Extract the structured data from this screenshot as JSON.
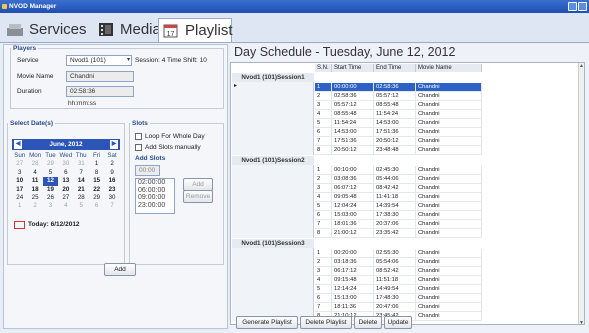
{
  "window": {
    "title": "NVOD Manager"
  },
  "tabs": [
    {
      "label": "Services",
      "icon": "services-icon"
    },
    {
      "label": "Media",
      "icon": "film-icon"
    },
    {
      "label": "Playlist",
      "icon": "calendar-icon"
    }
  ],
  "players": {
    "legend": "Players",
    "service_label": "Service",
    "service_value": "Nvod1 (101)",
    "session_info": "Session: 4 Time Shift: 10",
    "movie_label": "Movie Name",
    "movie_value": "Chandni",
    "duration_label": "Duration",
    "duration_value": "02:58:36",
    "duration_hint": "hh:mm:ss"
  },
  "dates": {
    "legend": "Select Date(s)",
    "month_title": "June, 2012",
    "weekdays": [
      "Sun",
      "Mon",
      "Tue",
      "Wed",
      "Thu",
      "Fri",
      "Sat"
    ],
    "weeks": [
      [
        "27",
        "28",
        "29",
        "30",
        "31",
        "1",
        "2"
      ],
      [
        "3",
        "4",
        "5",
        "6",
        "7",
        "8",
        "9"
      ],
      [
        "10",
        "11",
        "12",
        "13",
        "14",
        "15",
        "16"
      ],
      [
        "17",
        "18",
        "19",
        "20",
        "21",
        "22",
        "23"
      ],
      [
        "24",
        "25",
        "26",
        "27",
        "28",
        "29",
        "30"
      ],
      [
        "1",
        "2",
        "3",
        "4",
        "5",
        "6",
        "7"
      ]
    ],
    "today_label": "Today: 6/12/2012"
  },
  "slots": {
    "legend": "Slots",
    "loop_label": "Loop For Whole Day",
    "manual_label": "Add Slots manually",
    "add_slots_title": "Add Slots",
    "time_value": "00:00",
    "slot_list": [
      "02:00:00",
      "06:00:00",
      "09:00:00",
      "23:00:00"
    ],
    "add_label": "Add",
    "remove_label": "Remove"
  },
  "left_add_button": "Add",
  "schedule": {
    "title": "Day Schedule - Tuesday, June 12, 2012",
    "columns": [
      "S.N.",
      "Start Time",
      "End Time",
      "Movie Name"
    ],
    "groups": [
      {
        "name": "Nvod1 (101)Session1",
        "rows": [
          [
            "1",
            "00:00:00",
            "02:58:36",
            "Chandni"
          ],
          [
            "2",
            "02:58:36",
            "05:57:12",
            "Chandni"
          ],
          [
            "3",
            "05:57:12",
            "08:55:48",
            "Chandni"
          ],
          [
            "4",
            "08:55:48",
            "11:54:24",
            "Chandni"
          ],
          [
            "5",
            "11:54:24",
            "14:53:00",
            "Chandni"
          ],
          [
            "6",
            "14:53:00",
            "17:51:36",
            "Chandni"
          ],
          [
            "7",
            "17:51:36",
            "20:50:12",
            "Chandni"
          ],
          [
            "8",
            "20:50:12",
            "23:48:48",
            "Chandni"
          ]
        ]
      },
      {
        "name": "Nvod1 (101)Session2",
        "rows": [
          [
            "1",
            "00:10:00",
            "02:45:30",
            "Chandni"
          ],
          [
            "2",
            "03:08:36",
            "05:44:06",
            "Chandni"
          ],
          [
            "3",
            "06:07:12",
            "08:42:42",
            "Chandni"
          ],
          [
            "4",
            "09:05:48",
            "11:41:18",
            "Chandni"
          ],
          [
            "5",
            "12:04:24",
            "14:39:54",
            "Chandni"
          ],
          [
            "6",
            "15:03:00",
            "17:38:30",
            "Chandni"
          ],
          [
            "7",
            "18:01:36",
            "20:37:06",
            "Chandni"
          ],
          [
            "8",
            "21:00:12",
            "23:35:42",
            "Chandni"
          ]
        ]
      },
      {
        "name": "Nvod1 (101)Session3",
        "rows": [
          [
            "1",
            "00:20:00",
            "02:55:30",
            "Chandni"
          ],
          [
            "2",
            "03:18:36",
            "05:54:06",
            "Chandni"
          ],
          [
            "3",
            "06:17:12",
            "08:52:42",
            "Chandni"
          ],
          [
            "4",
            "09:15:48",
            "11:51:18",
            "Chandni"
          ],
          [
            "5",
            "12:14:24",
            "14:49:54",
            "Chandni"
          ],
          [
            "6",
            "15:13:00",
            "17:48:30",
            "Chandni"
          ],
          [
            "7",
            "18:11:36",
            "20:47:06",
            "Chandni"
          ],
          [
            "8",
            "21:10:12",
            "23:45:42",
            "Chandni"
          ]
        ]
      }
    ]
  },
  "actions": {
    "generate": "Generate Playlist",
    "delete_playlist": "Delete Playlist",
    "delete": "Delete",
    "update": "Update"
  }
}
